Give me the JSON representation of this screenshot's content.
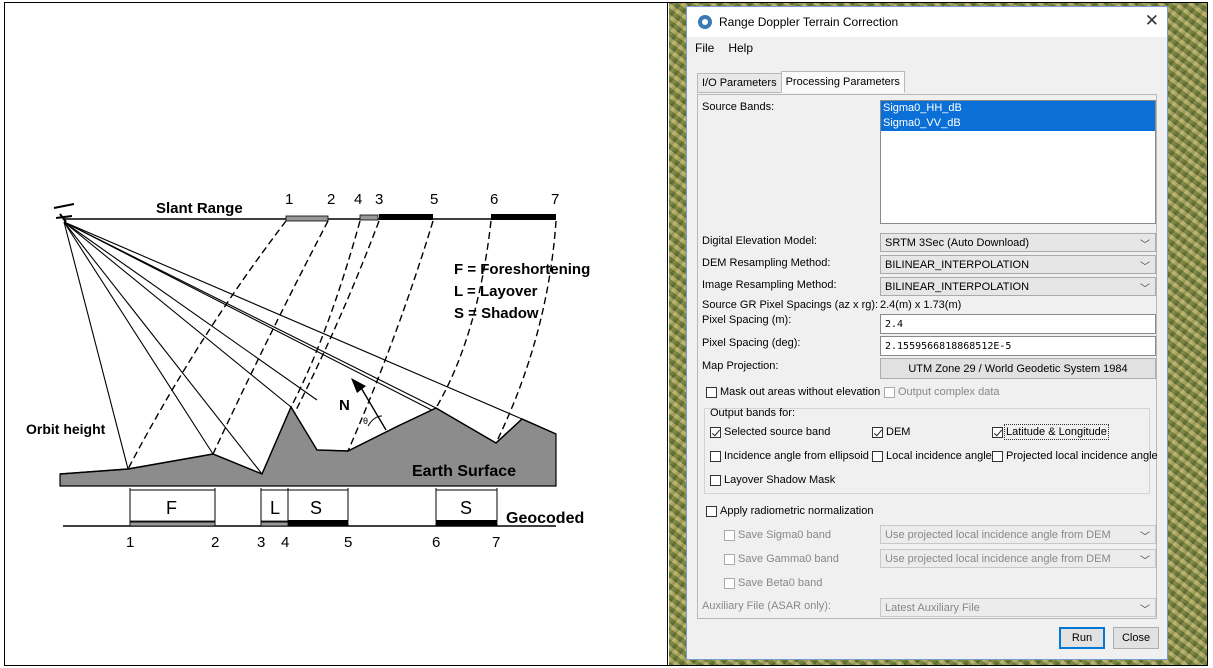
{
  "diagram": {
    "slant_range_label": "Slant Range",
    "orbit_height_label": "Orbit height",
    "earth_surface_label": "Earth Surface",
    "geocoded_label": "Geocoded",
    "north_label": "N",
    "theta_label": "θ",
    "legend": [
      "F = Foreshortening",
      "L = Layover",
      "S = Shadow"
    ],
    "top_numbers": [
      "1",
      "2",
      "4",
      "3",
      "5",
      "6",
      "7"
    ],
    "bottom_numbers": [
      "1",
      "2",
      "3",
      "4",
      "5",
      "6",
      "7"
    ],
    "segment_letters": [
      "F",
      "L",
      "S",
      "S"
    ]
  },
  "dialog": {
    "title": "Range Doppler Terrain Correction",
    "menu": [
      "File",
      "Help"
    ],
    "tabs": [
      "I/O Parameters",
      "Processing Parameters"
    ],
    "active_tab": "Processing Parameters",
    "source_bands_label": "Source Bands:",
    "source_bands": [
      "Sigma0_HH_dB",
      "Sigma0_VV_dB"
    ],
    "dem_label": "Digital Elevation Model:",
    "dem_value": "SRTM 3Sec (Auto Download)",
    "dem_resampling_label": "DEM Resampling Method:",
    "dem_resampling_value": "BILINEAR_INTERPOLATION",
    "img_resampling_label": "Image Resampling Method:",
    "img_resampling_value": "BILINEAR_INTERPOLATION",
    "gr_spacing_label": "Source GR Pixel Spacings (az x rg):",
    "gr_spacing_value": "2.4(m) x 1.73(m)",
    "pixel_m_label": "Pixel Spacing (m):",
    "pixel_m_value": "2.4",
    "pixel_deg_label": "Pixel Spacing (deg):",
    "pixel_deg_value": "2.1559566818868512E-5",
    "map_proj_label": "Map Projection:",
    "map_proj_value": "UTM Zone 29 / World Geodetic System 1984",
    "mask_label": "Mask out areas without elevation",
    "complex_label": "Output complex data",
    "output_bands_label": "Output bands for:",
    "cb_selected_source": "Selected source band",
    "cb_dem": "DEM",
    "cb_latlon": "Latitude & Longitude",
    "cb_incidence_ellipsoid": "Incidence angle from ellipsoid",
    "cb_local_incidence": "Local incidence angle",
    "cb_projected_local": "Projected local incidence angle",
    "cb_layover_mask": "Layover Shadow Mask",
    "radiometric_label": "Apply radiometric normalization",
    "save_sigma0": "Save Sigma0 band",
    "save_gamma0": "Save Gamma0 band",
    "save_beta0": "Save Beta0 band",
    "sigma0_combo": "Use projected local incidence angle from DEM",
    "gamma0_combo": "Use projected local incidence angle from DEM",
    "aux_label": "Auxiliary File (ASAR only):",
    "aux_value": "Latest Auxiliary File",
    "run_label": "Run",
    "close_label": "Close"
  }
}
